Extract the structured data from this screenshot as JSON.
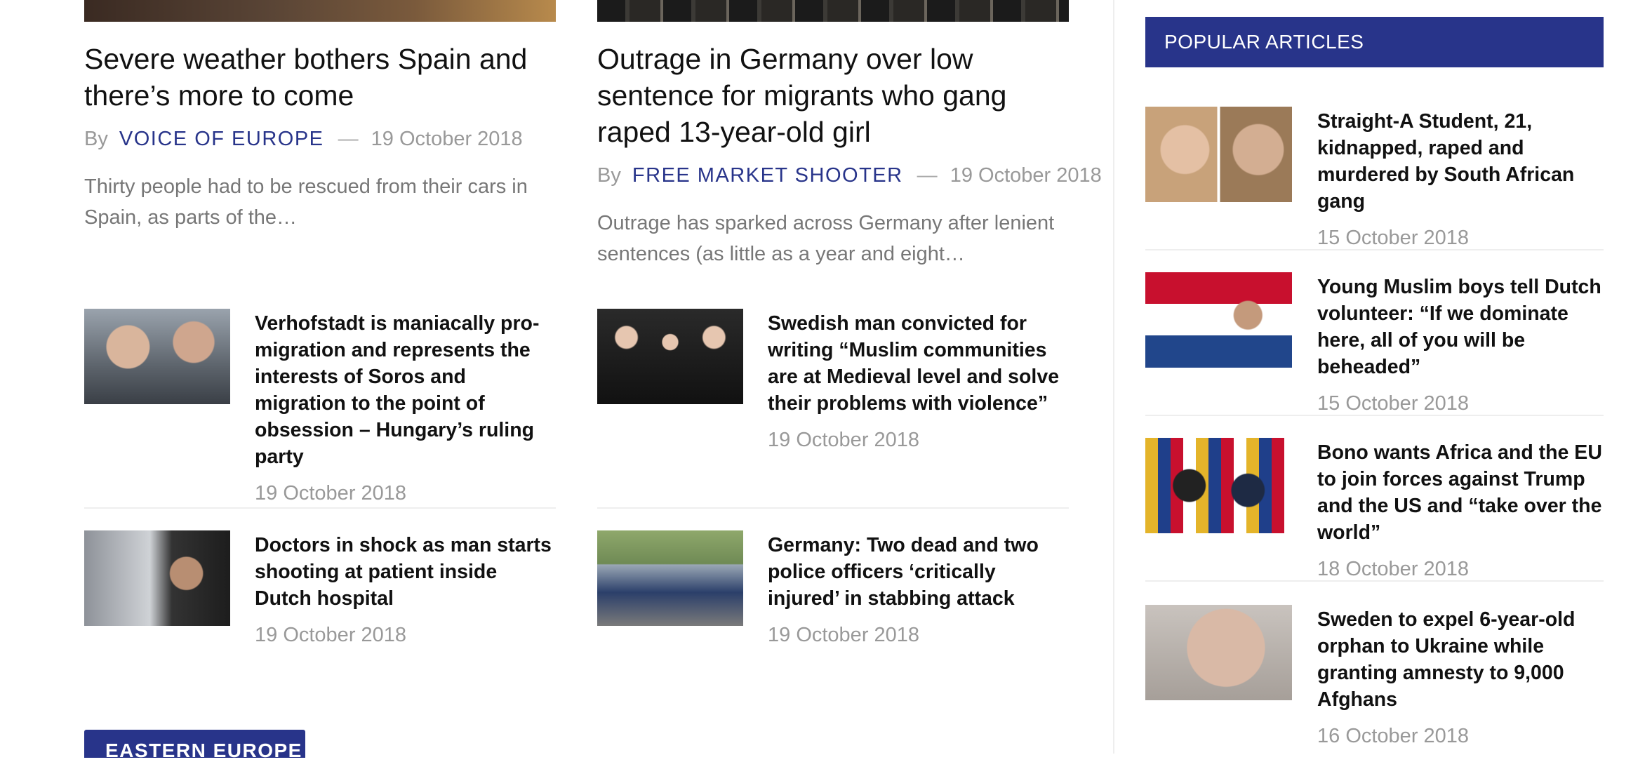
{
  "feature_left": {
    "title": "Severe weather bothers Spain and there’s more to come",
    "by": "By",
    "author": "VOICE OF EUROPE",
    "dash": "—",
    "date": "19 October 2018",
    "excerpt": "Thirty people had to be rescued from their cars in Spain, as parts of the…"
  },
  "feature_right": {
    "title": "Outrage in Germany over low sentence for migrants who gang raped 13-year-old girl",
    "by": "By",
    "author": "FREE MARKET SHOOTER",
    "dash": "—",
    "date": "19 October 2018",
    "excerpt": "Outrage has sparked across Germany after lenient sentences (as little as a year and eight…"
  },
  "list_left": [
    {
      "title": "Verhofstadt is maniacally pro-migration and represents the interests of Soros and migration to the point of obsession – Hungary’s ruling party",
      "date": "19 October 2018"
    },
    {
      "title": "Doctors in shock as man starts shooting at patient inside Dutch hospital",
      "date": "19 October 2018"
    }
  ],
  "list_right": [
    {
      "title": "Swedish man convicted for writing “Muslim communities are at Medieval level and solve their problems with violence”",
      "date": "19 October 2018"
    },
    {
      "title": "Germany: Two dead and two police officers ‘critically injured’ in stabbing attack",
      "date": "19 October 2018"
    }
  ],
  "sidebar": {
    "header": "POPULAR ARTICLES",
    "items": [
      {
        "title": "Straight-A Student, 21, kidnapped, raped and murdered by South African gang",
        "date": "15 October 2018"
      },
      {
        "title": "Young Muslim boys tell Dutch volunteer: “If we dominate here, all of you will be beheaded”",
        "date": "15 October 2018"
      },
      {
        "title": "Bono wants Africa and the EU to join forces against Trump and the US and “take over the world”",
        "date": "18 October 2018"
      },
      {
        "title": "Sweden to expel 6-year-old orphan to Ukraine while granting amnesty to 9,000 Afghans",
        "date": "16 October 2018"
      }
    ]
  },
  "section_tag": "EASTERN EUROPE"
}
